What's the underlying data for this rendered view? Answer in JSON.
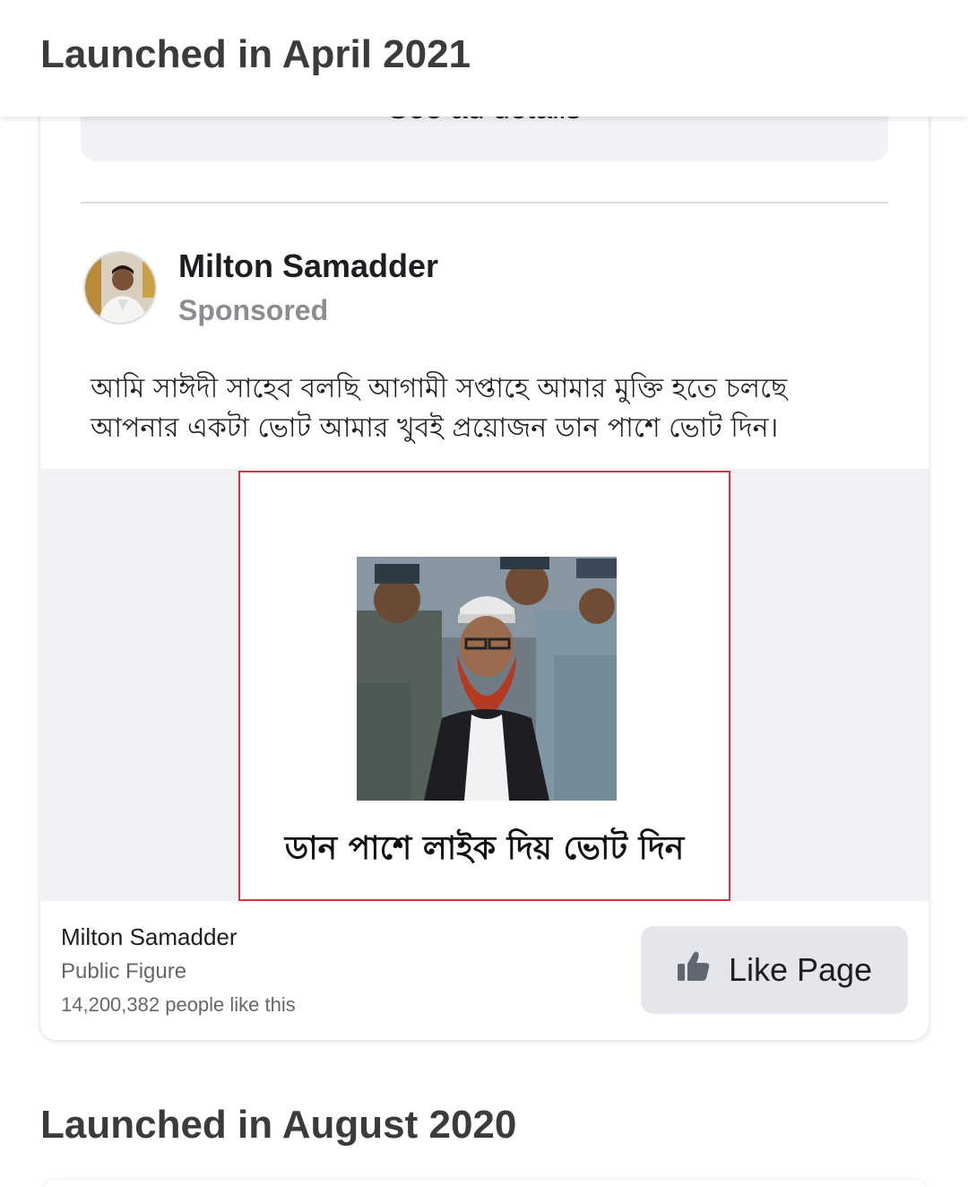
{
  "header": {
    "title": "Launched in April 2021"
  },
  "ad": {
    "see_details_label": "See ad details",
    "author_name": "Milton Samadder",
    "sponsored_label": "Sponsored",
    "post_text_line1": "আমি সাঈদী সাহেব বলছি আগামী সপ্তাহে আমার মুক্তি হতে চলছে",
    "post_text_line2": "আপনার একটা ভোট আমার খুবই প্রয়োজন ডান পাশে ভোট দিন।",
    "image_caption": "ডান পাশে লাইক দিয় ভোট দিন",
    "page_name": "Milton Samadder",
    "page_category": "Public Figure",
    "page_likes": "14,200,382 people like this",
    "like_button_label": "Like Page",
    "icons": {
      "like": "thumbs-up-icon"
    },
    "colors": {
      "image_border": "#d9323e",
      "button_bg": "#e4e6eb",
      "muted_text": "#65676b"
    }
  },
  "next_section": {
    "title": "Launched in August 2020"
  }
}
